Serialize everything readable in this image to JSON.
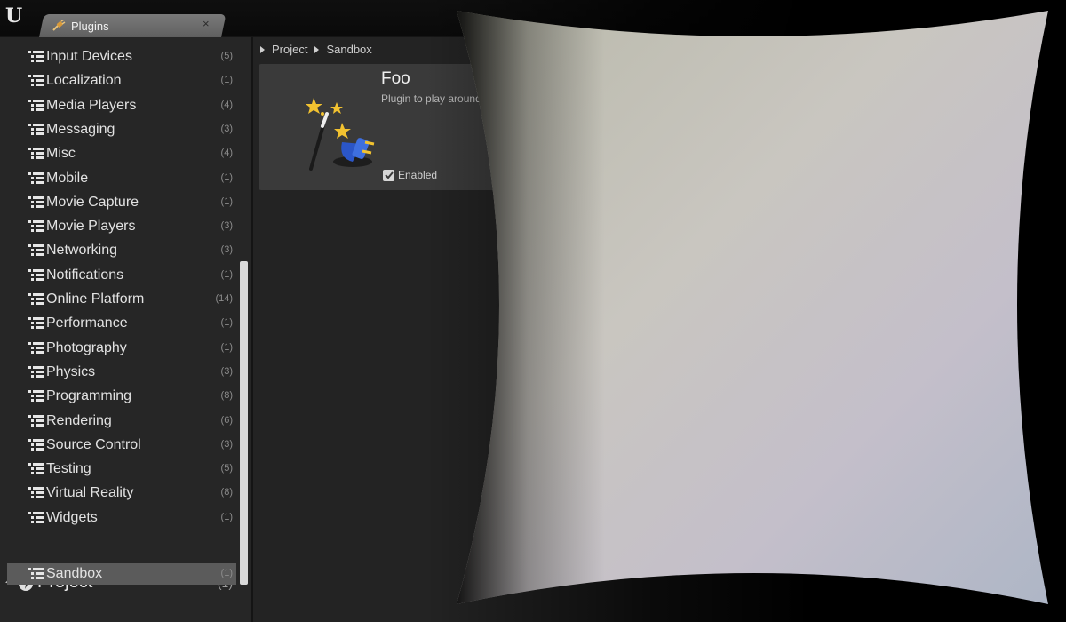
{
  "app": {
    "logo": "U"
  },
  "tab": {
    "title": "Plugins",
    "close": "×",
    "icon": "plug-icon"
  },
  "sidebar": {
    "items": [
      {
        "label": "Input Devices",
        "count": "(5)"
      },
      {
        "label": "Localization",
        "count": "(1)"
      },
      {
        "label": "Media Players",
        "count": "(4)"
      },
      {
        "label": "Messaging",
        "count": "(3)"
      },
      {
        "label": "Misc",
        "count": "(4)"
      },
      {
        "label": "Mobile",
        "count": "(1)"
      },
      {
        "label": "Movie Capture",
        "count": "(1)"
      },
      {
        "label": "Movie Players",
        "count": "(3)"
      },
      {
        "label": "Networking",
        "count": "(3)"
      },
      {
        "label": "Notifications",
        "count": "(1)"
      },
      {
        "label": "Online Platform",
        "count": "(14)"
      },
      {
        "label": "Performance",
        "count": "(1)"
      },
      {
        "label": "Photography",
        "count": "(1)"
      },
      {
        "label": "Physics",
        "count": "(3)"
      },
      {
        "label": "Programming",
        "count": "(8)"
      },
      {
        "label": "Rendering",
        "count": "(6)"
      },
      {
        "label": "Source Control",
        "count": "(3)"
      },
      {
        "label": "Testing",
        "count": "(5)"
      },
      {
        "label": "Virtual Reality",
        "count": "(8)"
      },
      {
        "label": "Widgets",
        "count": "(1)"
      }
    ],
    "group": {
      "label": "Project",
      "count": "(1)"
    },
    "selected": {
      "label": "Sandbox",
      "count": "(1)"
    }
  },
  "breadcrumb": [
    "Project",
    "Sandbox"
  ],
  "plugin": {
    "name": "Foo",
    "description": "Plugin to play around with shaders.",
    "enabled_label": "Enabled",
    "enabled": true
  }
}
